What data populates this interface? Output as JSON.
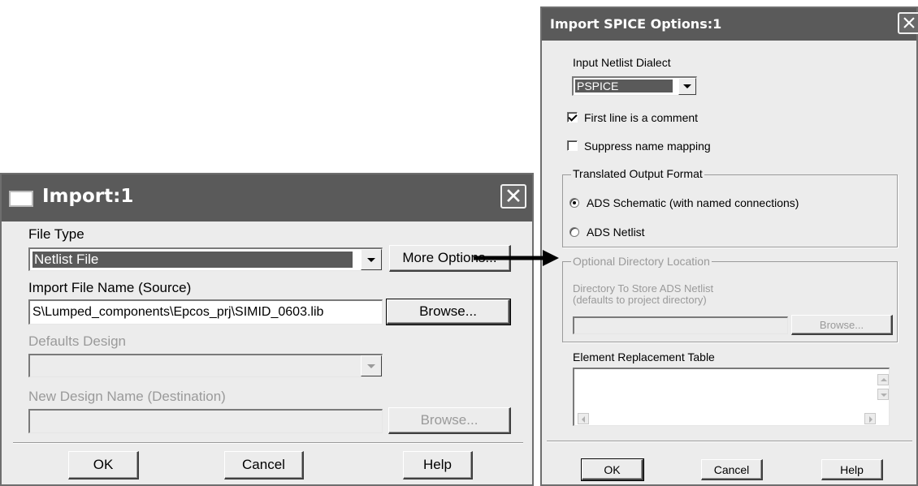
{
  "import_dialog": {
    "title": "Import:1",
    "file_type_label": "File Type",
    "file_type_value": "Netlist File",
    "more_options_label": "More Options...",
    "import_file_label": "Import File Name (Source)",
    "import_file_value": "S\\Lumped_components\\Epcos_prj\\SIMID_0603.lib",
    "browse_label": "Browse...",
    "defaults_design_label": "Defaults Design",
    "defaults_design_value": "",
    "new_design_label": "New Design Name (Destination)",
    "new_design_value": "",
    "browse2_label": "Browse...",
    "ok_label": "OK",
    "cancel_label": "Cancel",
    "help_label": "Help"
  },
  "spice_dialog": {
    "title": "Import SPICE Options:1",
    "dialect_label": "Input Netlist Dialect",
    "dialect_value": "PSPICE",
    "first_line_comment_label": "First line is a comment",
    "first_line_comment_checked": true,
    "suppress_mapping_label": "Suppress name mapping",
    "suppress_mapping_checked": false,
    "output_format_label": "Translated Output Format",
    "output_options": [
      {
        "label": "ADS Schematic (with named connections)",
        "selected": true
      },
      {
        "label": "ADS Netlist",
        "selected": false
      }
    ],
    "optional_dir_label": "Optional Directory Location",
    "dir_store_label": "Directory To Store ADS Netlist",
    "dir_default_label": "(defaults to project directory)",
    "dir_value": "",
    "browse_label": "Browse...",
    "element_table_label": "Element Replacement Table",
    "ok_label": "OK",
    "cancel_label": "Cancel",
    "help_label": "Help"
  },
  "colors": {
    "titlebar": "#5a5a5a",
    "window_bg": "#ececec",
    "disabled_text": "#9a9a9a"
  }
}
